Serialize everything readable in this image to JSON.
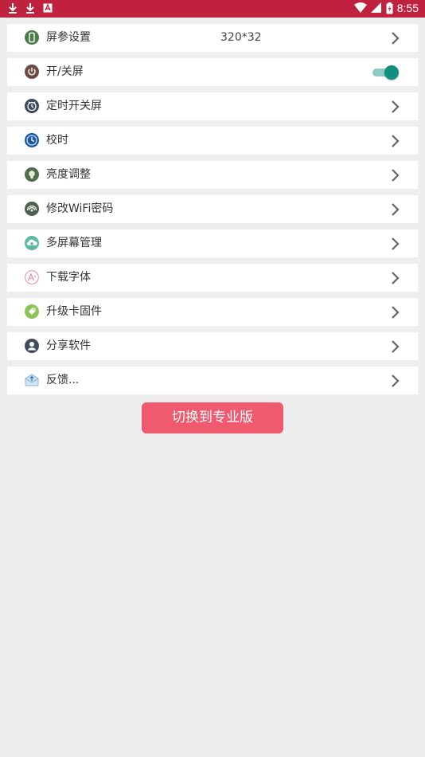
{
  "status_bar": {
    "time": "8:55",
    "left_icons": [
      "download-icon",
      "download-icon",
      "app-notification-icon"
    ],
    "right_icons": [
      "wifi-icon",
      "signal-icon",
      "battery-icon"
    ],
    "color": "#c0213f"
  },
  "settings": {
    "items": [
      {
        "label": "屏参设置",
        "value": "320*32",
        "icon": "phone-icon",
        "control": "chevron"
      },
      {
        "label": "开/关屏",
        "icon": "power-icon",
        "control": "toggle",
        "toggle_on": true
      },
      {
        "label": "定时开关屏",
        "icon": "timer-icon",
        "control": "chevron"
      },
      {
        "label": "校时",
        "icon": "clock-icon",
        "control": "chevron"
      },
      {
        "label": "亮度调整",
        "icon": "brightness-icon",
        "control": "chevron"
      },
      {
        "label": "修改WiFi密码",
        "icon": "wifi-signal-icon",
        "control": "chevron"
      },
      {
        "label": "多屏幕管理",
        "icon": "cloud-upload-icon",
        "control": "chevron"
      },
      {
        "label": "下载字体",
        "icon": "font-icon",
        "control": "chevron"
      },
      {
        "label": "升级卡固件",
        "icon": "tag-icon",
        "control": "chevron"
      },
      {
        "label": "分享软件",
        "icon": "user-icon",
        "control": "chevron"
      },
      {
        "label": "反馈...",
        "icon": "mail-icon",
        "control": "chevron"
      }
    ]
  },
  "pro_button": {
    "label": "切换到专业版",
    "color": "#ef5a6e"
  },
  "colors": {
    "background": "#eeeeee",
    "toggle_on": "#0f8f7e"
  }
}
